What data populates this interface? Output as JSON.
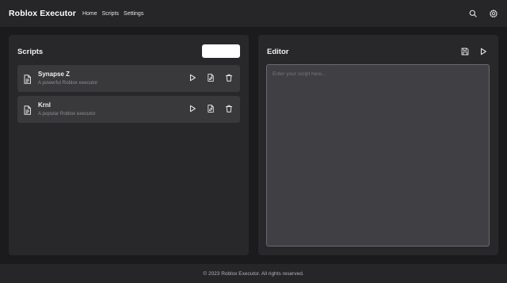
{
  "header": {
    "brand": "Roblox Executor",
    "nav": [
      {
        "label": "Home"
      },
      {
        "label": "Scripts"
      },
      {
        "label": "Settings"
      }
    ],
    "icons": [
      "search-icon",
      "settings-icon"
    ]
  },
  "scripts_panel": {
    "title": "Scripts",
    "new_button_label": "",
    "items": [
      {
        "name": "Synapse Z",
        "description": "A powerful Roblox executor"
      },
      {
        "name": "Krnl",
        "description": "A popular Roblox executor"
      }
    ],
    "item_actions": [
      "play-icon",
      "file-edit-icon",
      "trash-icon"
    ]
  },
  "editor_panel": {
    "title": "Editor",
    "placeholder": "Enter your script here...",
    "value": "",
    "actions": [
      "save-icon",
      "play-icon"
    ]
  },
  "footer": {
    "text": "© 2023 Roblox Executor. All rights reserved."
  },
  "colors": {
    "background": "#1b1b1d",
    "bar": "#262628",
    "panel": "#28282a",
    "card": "#39393c",
    "editor": "#404044",
    "accent_button": "#ffffff"
  }
}
